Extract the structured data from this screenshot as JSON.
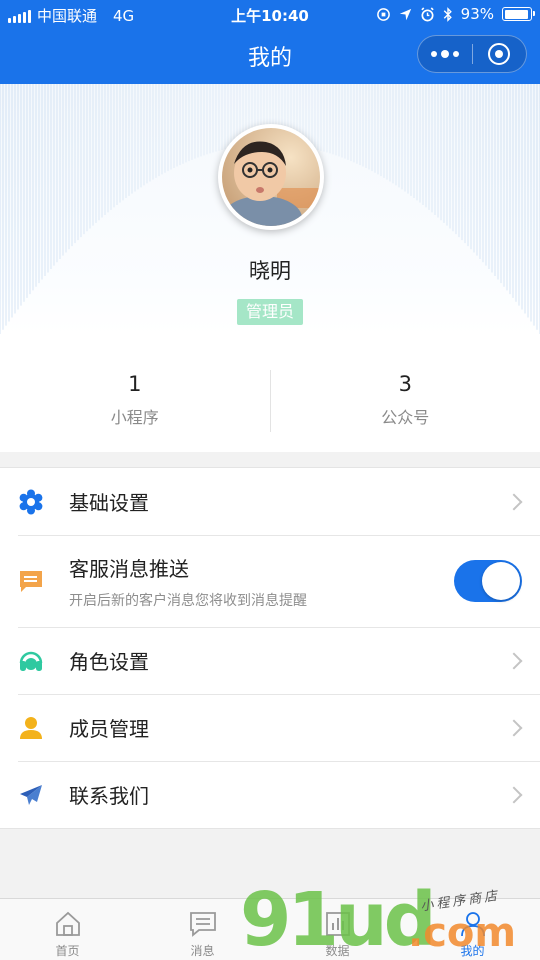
{
  "status_bar": {
    "carrier": "中国联通",
    "network": "4G",
    "time": "上午10:40",
    "battery": "93%",
    "battery_level": 0.93
  },
  "nav": {
    "title": "我的",
    "more_icon": "ellipsis-icon",
    "close_icon": "target-icon"
  },
  "profile": {
    "name": "晓明",
    "role": "管理员"
  },
  "stats": [
    {
      "value": "1",
      "label": "小程序"
    },
    {
      "value": "3",
      "label": "公众号"
    }
  ],
  "menu": [
    {
      "label": "基础设置",
      "icon": "gear-icon",
      "color": "#1a73ea"
    },
    {
      "label": "客服消息推送",
      "desc": "开启后新的客户消息您将收到消息提醒",
      "icon": "message-icon",
      "color": "#f3a44a",
      "toggle_on": true
    },
    {
      "label": "角色设置",
      "icon": "headset-icon",
      "color": "#2fc9a0"
    },
    {
      "label": "成员管理",
      "icon": "person-icon",
      "color": "#f3b21b"
    },
    {
      "label": "联系我们",
      "icon": "paper-plane-icon",
      "color": "#2d5fb8"
    }
  ],
  "tabs": [
    {
      "label": "首页",
      "icon": "home-icon"
    },
    {
      "label": "消息",
      "icon": "chat-icon"
    },
    {
      "label": "数据",
      "icon": "chart-icon"
    },
    {
      "label": "我的",
      "icon": "user-icon",
      "active": true
    }
  ],
  "watermark": {
    "main": "91ud",
    "suffix": ".com",
    "caption": "小程序商店"
  },
  "colors": {
    "primary": "#1a73ea",
    "badge": "#a5e6c7"
  }
}
